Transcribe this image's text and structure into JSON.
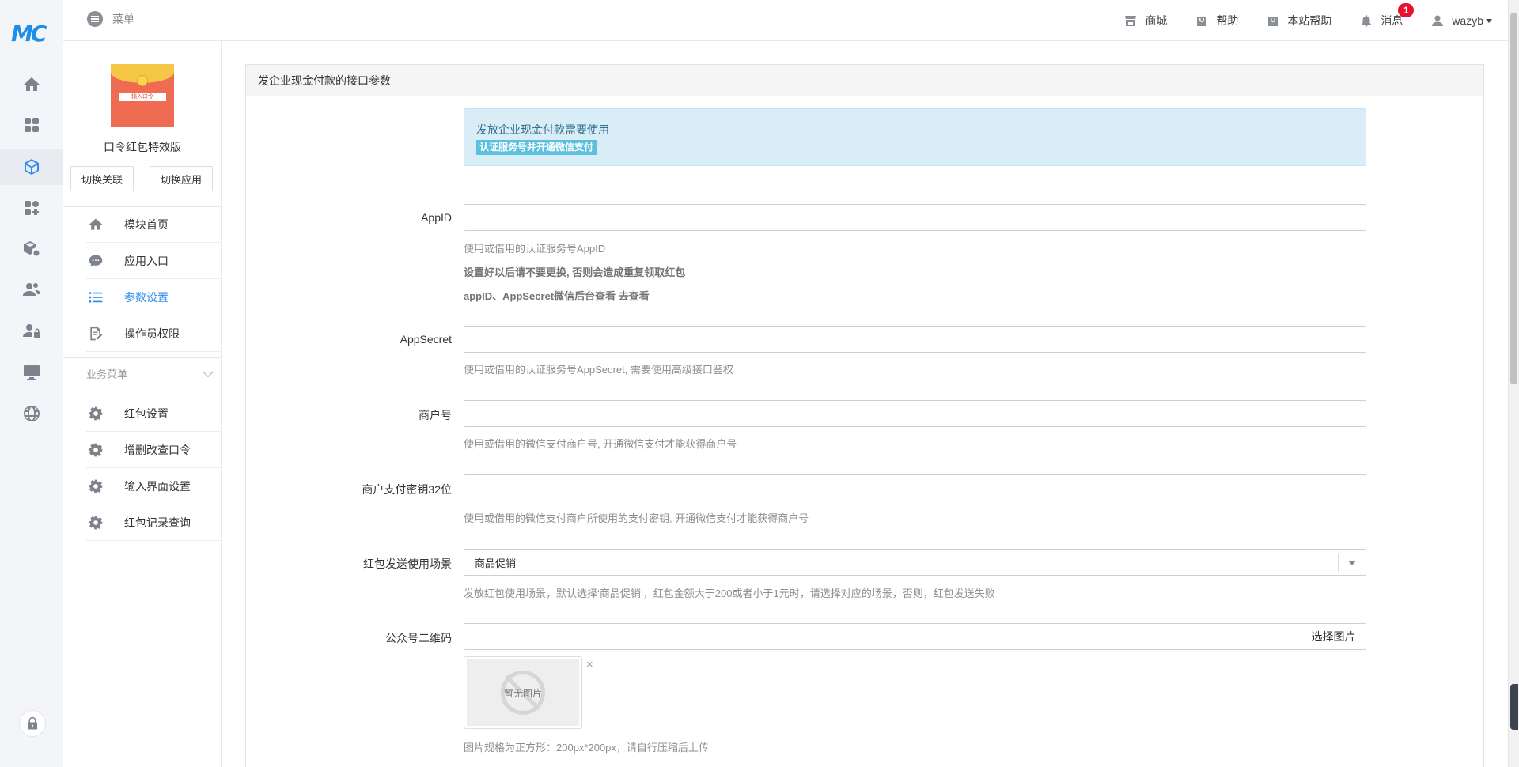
{
  "app": {
    "logo_text": "MC"
  },
  "rail": {
    "icons": [
      "home-icon",
      "grid-icon",
      "cube-icon",
      "apps-icon",
      "package-settings-icon",
      "users-icon",
      "user-lock-icon",
      "monitor-icon",
      "globe-icon"
    ],
    "active_index": 2,
    "bottom_icon": "lock-icon"
  },
  "topbar": {
    "menu_label": "菜单",
    "links": [
      {
        "label": "商城",
        "icon": "store-icon"
      },
      {
        "label": "帮助",
        "icon": "bag-icon"
      },
      {
        "label": "本站帮助",
        "icon": "bag-icon"
      },
      {
        "label": "消息",
        "icon": "bell-icon",
        "badge": "1"
      }
    ],
    "user": "wazyb"
  },
  "module": {
    "name": "口令红包特效版",
    "image_label": "输入口令",
    "btn_switch_link": "切换关联",
    "btn_switch_app": "切换应用",
    "nav": [
      {
        "label": "模块首页",
        "icon": "home-icon"
      },
      {
        "label": "应用入口",
        "icon": "chat-icon"
      },
      {
        "label": "参数设置",
        "icon": "list-icon",
        "active": true
      },
      {
        "label": "操作员权限",
        "icon": "edit-doc-icon"
      }
    ],
    "section_title": "业务菜单",
    "business": [
      {
        "label": "红包设置",
        "icon": "gear-icon"
      },
      {
        "label": "增删改查口令",
        "icon": "gear-icon"
      },
      {
        "label": "输入界面设置",
        "icon": "gear-icon"
      },
      {
        "label": "红包记录查询",
        "icon": "gear-icon"
      }
    ]
  },
  "panel": {
    "title": "发企业现金付款的接口参数",
    "alert_text": "发放企业现金付款需要使用",
    "alert_tag": "认证服务号并开通微信支付",
    "fields": {
      "appid": {
        "label": "AppID",
        "value": "",
        "help1": "使用或借用的认证服务号AppID",
        "help2": "设置好以后请不要更换, 否则会造成重复领取红包",
        "help3": "appID、AppSecret微信后台查看 去查看"
      },
      "appsecret": {
        "label": "AppSecret",
        "value": "",
        "help": "使用或借用的认证服务号AppSecret, 需要使用高级接口鉴权"
      },
      "mchid": {
        "label": "商户号",
        "value": "",
        "help": "使用或借用的微信支付商户号, 开通微信支付才能获得商户号"
      },
      "mchkey": {
        "label": "商户支付密钥32位",
        "value": "",
        "help": "使用或借用的微信支付商户所使用的支付密钥, 开通微信支付才能获得商户号"
      },
      "scene": {
        "label": "红包发送使用场景",
        "selected": "商品促销",
        "help": "发放红包使用场景，默认选择‘商品促销’，红包金额大于200或者小于1元时，请选择对应的场景，否则，红包发送失败"
      },
      "qrcode": {
        "label": "公众号二维码",
        "value": "",
        "button": "选择图片",
        "placeholder_text": "暂无图片",
        "close": "×",
        "help": "图片规格为正方形：200px*200px，请自行压缩后上传"
      }
    }
  }
}
